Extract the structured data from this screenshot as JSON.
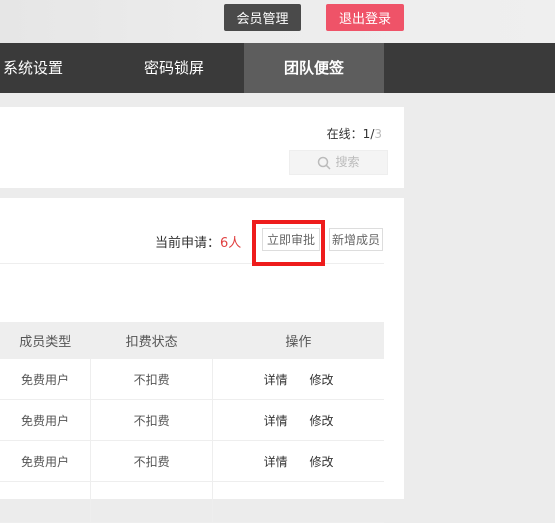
{
  "header": {
    "member_manage": "会员管理",
    "logout": "退出登录"
  },
  "nav": {
    "items": [
      {
        "label": "系统设置"
      },
      {
        "label": "密码锁屏"
      },
      {
        "label": "团队便签",
        "active": true
      }
    ]
  },
  "status": {
    "online_label": "在线：",
    "online_current": "1",
    "online_sep": "/",
    "online_total": "3"
  },
  "search": {
    "placeholder": "搜索",
    "icon": "search-icon"
  },
  "apply": {
    "label": "当前申请：",
    "count": "6人",
    "approve_button": "立即审批",
    "add_button": "新增成员"
  },
  "table": {
    "headers": [
      "成员类型",
      "扣费状态",
      "操作"
    ],
    "rows": [
      {
        "type": "免费用户",
        "charge": "不扣费",
        "detail": "详情",
        "edit": "修改"
      },
      {
        "type": "免费用户",
        "charge": "不扣费",
        "detail": "详情",
        "edit": "修改"
      },
      {
        "type": "免费用户",
        "charge": "不扣费",
        "detail": "详情",
        "edit": "修改"
      }
    ]
  },
  "colors": {
    "nav_bg": "#3a3a3a",
    "nav_active": "#5d5d5d",
    "logout_bg": "#ef5368",
    "member_bg": "#4a4a4a",
    "highlight": "#ee1c1c",
    "count": "#e04040"
  }
}
